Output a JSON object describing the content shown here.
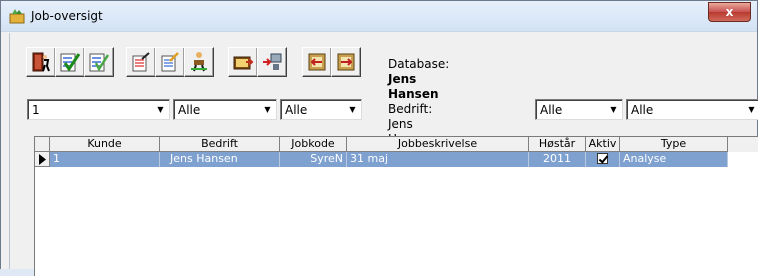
{
  "window": {
    "title": "Job-oversigt",
    "close_glyph": "x"
  },
  "toolbar": {
    "buttons": [
      {
        "icon": "exit-door-icon"
      },
      {
        "icon": "checklist-green-icon"
      },
      {
        "icon": "checklist-check-icon"
      },
      {
        "icon": "edit-list-icon"
      },
      {
        "icon": "edit-list-pencil-icon"
      },
      {
        "icon": "worker-figure-icon"
      },
      {
        "icon": "print-preview-icon"
      },
      {
        "icon": "computer-arrow-icon"
      },
      {
        "icon": "import-icon"
      },
      {
        "icon": "export-icon"
      }
    ]
  },
  "database": {
    "label": "Database:",
    "name": "Jens Hansen",
    "company_label": "Bedrift:",
    "company": "Jens Hansen"
  },
  "filters": {
    "kunde": "1",
    "bedrift": "Alle",
    "jobkode": "Alle",
    "aar": "Alle",
    "type": "Alle"
  },
  "grid": {
    "columns": [
      "Kunde",
      "Bedrift",
      "Jobkode",
      "Jobbeskrivelse",
      "Høstår",
      "Aktiv",
      "Type"
    ],
    "rows": [
      {
        "kunde": "1",
        "bedrift": "Jens Hansen",
        "jobkode": "SyreN",
        "jobbeskrivelse": "31 maj",
        "hoestaar": "2011",
        "aktiv": true,
        "type": "Analyse"
      }
    ]
  },
  "colors": {
    "selected_row": "#7ea1d0",
    "title_gradient_top": "#e7f0fb",
    "close_button": "#c75050"
  }
}
